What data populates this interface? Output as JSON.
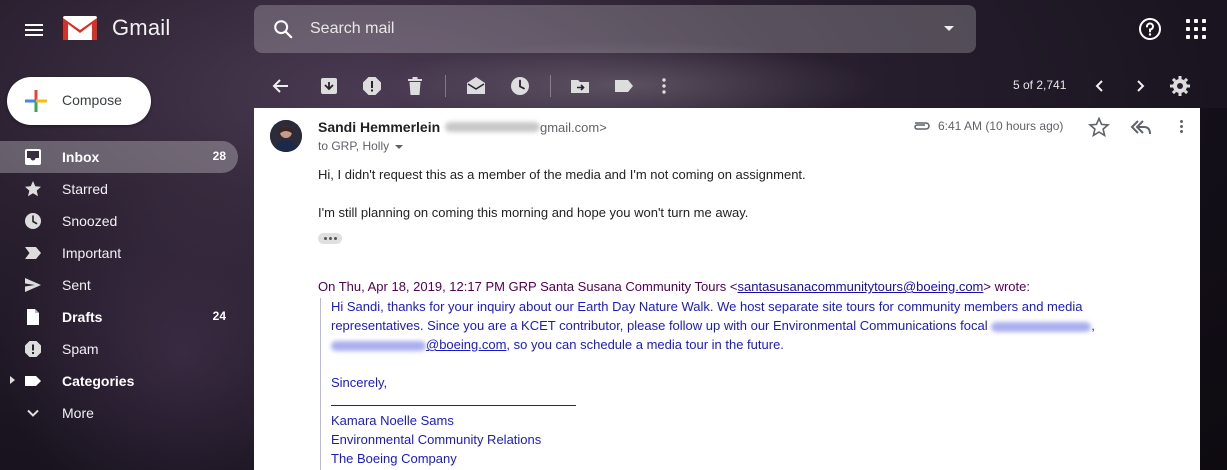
{
  "app": {
    "logo_text": "Gmail"
  },
  "search": {
    "placeholder": "Search mail"
  },
  "compose": {
    "label": "Compose"
  },
  "sidebar": {
    "items": [
      {
        "label": "Inbox",
        "count": "28",
        "icon": "inbox-icon",
        "bold": true,
        "active": true
      },
      {
        "label": "Starred",
        "count": "",
        "icon": "star-icon"
      },
      {
        "label": "Snoozed",
        "count": "",
        "icon": "clock-icon"
      },
      {
        "label": "Important",
        "count": "",
        "icon": "important-icon"
      },
      {
        "label": "Sent",
        "count": "",
        "icon": "send-icon"
      },
      {
        "label": "Drafts",
        "count": "24",
        "icon": "draft-icon",
        "bold": true
      },
      {
        "label": "Spam",
        "count": "",
        "icon": "spam-icon"
      },
      {
        "label": "Categories",
        "count": "",
        "icon": "label-icon",
        "bold": true
      },
      {
        "label": "More",
        "count": "",
        "icon": "chevron-down-icon"
      }
    ]
  },
  "toolbar": {
    "page_count": "5 of 2,741"
  },
  "message": {
    "sender_name": "Sandi Hemmerlein",
    "sender_email_suffix": "gmail.com>",
    "to_line": "to GRP, Holly",
    "timestamp": "6:41 AM (10 hours ago)",
    "body_line_1": "Hi, I didn't request this as a member of the media and I'm not coming on assignment.",
    "body_line_2": "I'm still planning on coming this morning and hope you won't turn me away.",
    "quote_header_prefix": "On Thu, Apr 18, 2019, 12:17 PM GRP Santa Susana Community Tours <",
    "quote_header_link": "santasusanacommunitytours@boeing.com",
    "quote_header_suffix": "> wrote:",
    "quote_line_1": "Hi Sandi, thanks for your inquiry about our Earth Day Nature Walk.  We host separate site tours for community members and media",
    "quote_line_2": "representatives.  Since you are a KCET contributor, please follow up with our Environmental Communications focal",
    "quote_line_2_end": ",",
    "quote_line_3_link": "@boeing.com",
    "quote_line_3_rest": ", so you can schedule a media tour in the future.",
    "sign_off": "Sincerely,",
    "sig_name": "Kamara Noelle Sams",
    "sig_title": "Environmental Community Relations",
    "sig_company": "The Boeing Company"
  },
  "colors": {
    "gmail_red": "#d93025",
    "link_blue": "#1a1acc",
    "quote_purple": "#500050"
  }
}
